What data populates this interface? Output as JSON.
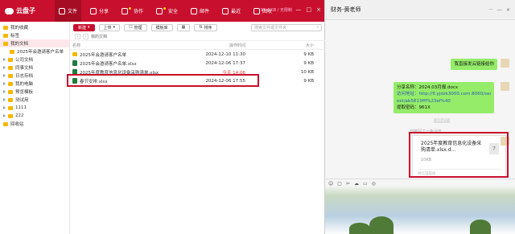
{
  "app": {
    "logo": "云盘子",
    "nav": [
      {
        "label": "文件",
        "active": true
      },
      {
        "label": "分享",
        "active": false
      },
      {
        "label": "协作",
        "active": false
      },
      {
        "label": "安全",
        "active": false
      },
      {
        "label": "邮件",
        "active": false
      },
      {
        "label": "最近",
        "active": false
      },
      {
        "label": "回收",
        "active": false
      }
    ],
    "storage": "93.4 KB / 无限制",
    "window_controls": [
      "—",
      "□",
      "×"
    ]
  },
  "sidebar": [
    {
      "label": "我的收藏",
      "sub": false
    },
    {
      "label": "标签",
      "sub": false
    },
    {
      "label": "我的文档",
      "sub": false,
      "selected": true
    },
    {
      "label": "2025年会邀请客户名单",
      "sub": true
    },
    {
      "label": "公司文档",
      "sub": false
    },
    {
      "label": "同事文档",
      "sub": false
    },
    {
      "label": "日志存档",
      "sub": false
    },
    {
      "label": "我的电脑",
      "sub": false
    },
    {
      "label": "预览模板",
      "sub": false
    },
    {
      "label": "测试用",
      "sub": false
    },
    {
      "label": "1111",
      "sub": false
    },
    {
      "label": "222",
      "sub": false
    },
    {
      "label": "回收站",
      "sub": false
    }
  ],
  "toolbar": {
    "new_label": "新建",
    "upload_label": "上传",
    "manage_label": "管理",
    "template_label": "模板库",
    "sort_label": "排序",
    "search_placeholder": "搜索文件或文件夹"
  },
  "breadcrumb": "我的文档",
  "table": {
    "headers": {
      "name": "名称",
      "time": "操作时间",
      "size": "大小"
    },
    "rows": [
      {
        "name": "2025年会邀请客户名单",
        "time": "2024-12-10 11:30",
        "size": "9 KB",
        "type": "folder"
      },
      {
        "name": "2025年会邀请客户名单.xlsx",
        "time": "2024-12-06 17:37",
        "size": "9 KB",
        "type": "xlsx"
      },
      {
        "name": "2025年度教育信息化设备采购清单.xlsx",
        "time": "今天 14:06",
        "size": "10 KB",
        "type": "xlsx",
        "highlight": true
      },
      {
        "name": "春节安排.xlsx",
        "time": "2024-12-06 17:55",
        "size": "9 KB",
        "type": "xlsx"
      }
    ]
  },
  "chat": {
    "title": "财务-黄老师",
    "top_icons": [
      "···",
      "—",
      "×"
    ],
    "msg1": "我直接发云链接给你",
    "share": {
      "line1": "分享名称：2024.03月报.docx",
      "line2": "访问地址：http://fl.yjdzk3000.com:8060/servet/",
      "line3": "ext/ab5813fff%23ef%40",
      "line4": "提取密码：961X"
    },
    "time1": "14:27",
    "sys1": "你撤回了一条消息",
    "file": {
      "name": "2025年度教育信息化设备采购清单.xlsx.d...",
      "size": "10KB",
      "source": "微信电脑版",
      "icon": "?"
    },
    "time_under_share": "微信电脑版",
    "input_tools": [
      "☺",
      "▢",
      "✂",
      "☁",
      "▭",
      "◎"
    ]
  },
  "colors": {
    "brand_red": "#c8102e",
    "wechat_green": "#95ec69",
    "highlight_time": "#e53935"
  }
}
